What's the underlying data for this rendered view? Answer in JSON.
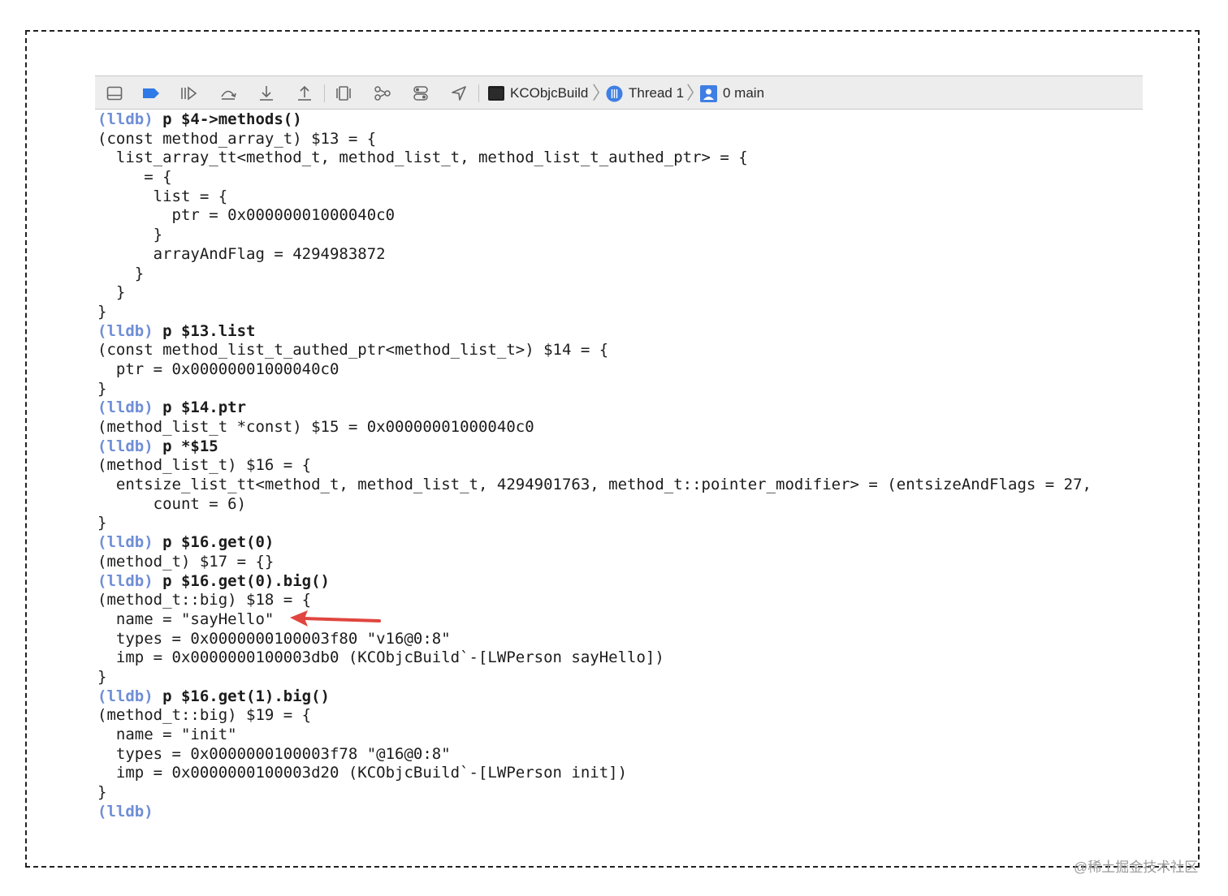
{
  "toolbar": {
    "icons": [
      "hide-debug-area-icon",
      "breakpoints-toggle-icon",
      "continue-icon",
      "step-over-icon",
      "step-into-icon",
      "step-out-icon",
      "view-hierarchy-icon",
      "memory-graph-icon",
      "environment-overrides-icon",
      "simulate-location-icon"
    ],
    "breadcrumb": {
      "target": "KCObjcBuild",
      "thread": "Thread 1",
      "frame": "0 main"
    }
  },
  "console": {
    "prompt": "(lldb)",
    "lines": [
      {
        "prompt": true,
        "cmd": " p $4->methods()"
      },
      {
        "text": "(const method_array_t) $13 = {"
      },
      {
        "text": "  list_array_tt<method_t, method_list_t, method_list_t_authed_ptr> = {"
      },
      {
        "text": "     = {"
      },
      {
        "text": "      list = {"
      },
      {
        "text": "        ptr = 0x00000001000040c0"
      },
      {
        "text": "      }"
      },
      {
        "text": "      arrayAndFlag = 4294983872"
      },
      {
        "text": "    }"
      },
      {
        "text": "  }"
      },
      {
        "text": "}"
      },
      {
        "prompt": true,
        "cmd": " p $13.list"
      },
      {
        "text": "(const method_list_t_authed_ptr<method_list_t>) $14 = {"
      },
      {
        "text": "  ptr = 0x00000001000040c0"
      },
      {
        "text": "}"
      },
      {
        "prompt": true,
        "cmd": " p $14.ptr"
      },
      {
        "text": "(method_list_t *const) $15 = 0x00000001000040c0"
      },
      {
        "prompt": true,
        "cmd": " p *$15"
      },
      {
        "text": "(method_list_t) $16 = {"
      },
      {
        "text": "  entsize_list_tt<method_t, method_list_t, 4294901763, method_t::pointer_modifier> = (entsizeAndFlags = 27,"
      },
      {
        "text": "      count = 6)"
      },
      {
        "text": "}"
      },
      {
        "prompt": true,
        "cmd": " p $16.get(0)"
      },
      {
        "text": "(method_t) $17 = {}"
      },
      {
        "prompt": true,
        "cmd": " p $16.get(0).big()"
      },
      {
        "text": "(method_t::big) $18 = {"
      },
      {
        "text": "  name = \"sayHello\""
      },
      {
        "text": "  types = 0x0000000100003f80 \"v16@0:8\""
      },
      {
        "text": "  imp = 0x0000000100003db0 (KCObjcBuild`-[LWPerson sayHello])"
      },
      {
        "text": "}"
      },
      {
        "prompt": true,
        "cmd": " p $16.get(1).big()"
      },
      {
        "text": "(method_t::big) $19 = {"
      },
      {
        "text": "  name = \"init\""
      },
      {
        "text": "  types = 0x0000000100003f78 \"@16@0:8\""
      },
      {
        "text": "  imp = 0x0000000100003d20 (KCObjcBuild`-[LWPerson init])"
      },
      {
        "text": "}"
      },
      {
        "prompt": true,
        "cmd": ""
      }
    ]
  },
  "annotation": {
    "arrow_color": "#e0463f",
    "points_to": "name = \"sayHello\""
  },
  "watermark": "@稀土掘金技术社区",
  "colors": {
    "prompt": "#6f8ed6",
    "toolbar_bg": "#ededed",
    "breakpoint_blue": "#2f7ae6"
  }
}
